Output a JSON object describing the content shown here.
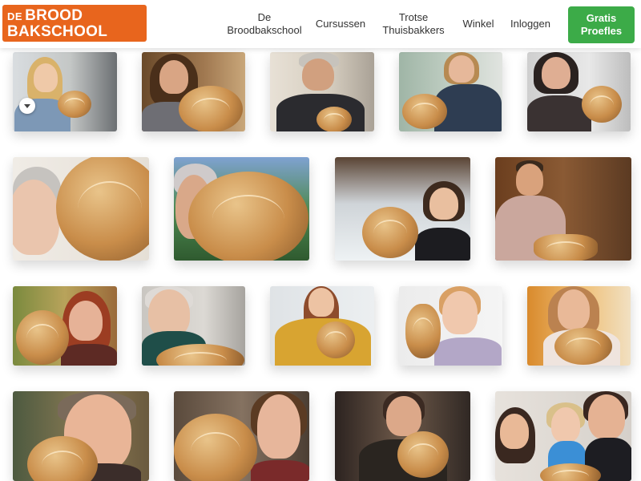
{
  "logo": {
    "prefix": "DE",
    "word1": "BROOD",
    "word2": "BAKSCHOOL"
  },
  "colors": {
    "brand_orange": "#e8651d",
    "cta_green": "#3cab48",
    "nav_text": "#333333"
  },
  "nav": {
    "items": [
      {
        "line1": "De",
        "line2": "Broodbakschool"
      },
      {
        "line1": "Cursussen",
        "line2": ""
      },
      {
        "line1": "Trotse",
        "line2": "Thuisbakkers"
      },
      {
        "line1": "Winkel",
        "line2": ""
      },
      {
        "line1": "Inloggen",
        "line2": ""
      }
    ],
    "cta": {
      "line1": "Gratis",
      "line2": "Proefles"
    }
  },
  "gallery": {
    "collapse_icon": "chevron-down-icon",
    "photos": [
      {
        "subject": "woman-with-loaf-kitchen"
      },
      {
        "subject": "woman-with-scored-loaf"
      },
      {
        "subject": "man-with-hat-and-loaf"
      },
      {
        "subject": "woman-with-loaf-green-wall"
      },
      {
        "subject": "woman-glasses-with-loaf"
      },
      {
        "subject": "selfie-with-large-loaf"
      },
      {
        "subject": "woman-with-loaf-outdoors"
      },
      {
        "subject": "woman-with-loaf-table"
      },
      {
        "subject": "man-with-bread-plank"
      },
      {
        "subject": "woman-surprised-with-loaf"
      },
      {
        "subject": "woman-white-hair-with-loaf"
      },
      {
        "subject": "woman-yellow-sweater-loaf"
      },
      {
        "subject": "girl-with-baguette"
      },
      {
        "subject": "woman-with-round-loaf"
      },
      {
        "subject": "woman-with-loaf-closeup"
      },
      {
        "subject": "woman-with-large-loaf"
      },
      {
        "subject": "man-with-loaf-fireplace"
      },
      {
        "subject": "family-with-loaf"
      }
    ]
  }
}
